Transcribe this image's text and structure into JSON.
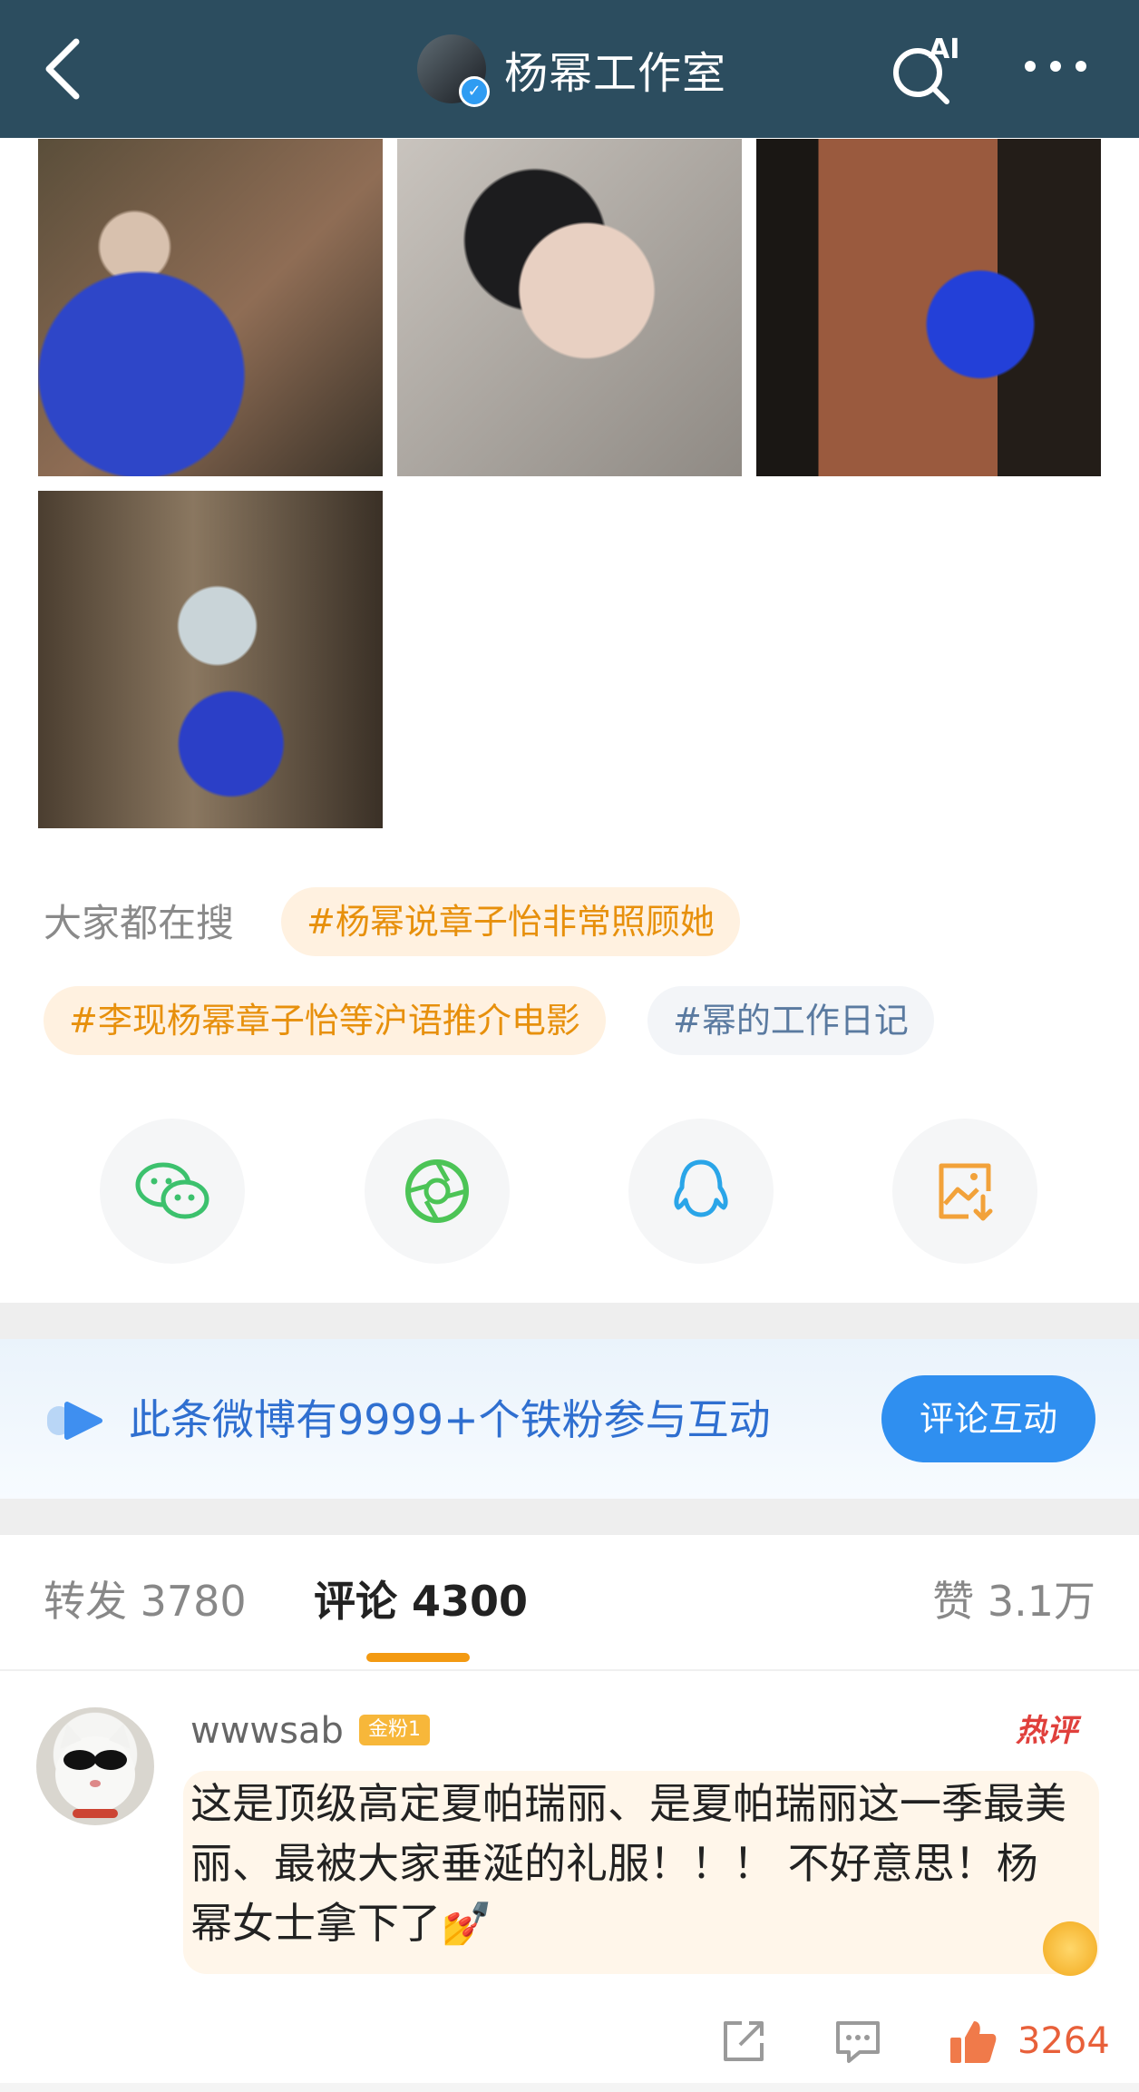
{
  "header": {
    "title": "杨幂工作室",
    "back_icon": "chevron-left-icon",
    "ai_label": "AI",
    "more_icon": "more-icon"
  },
  "hot_search": {
    "label": "大家都在搜",
    "tags": [
      {
        "text": "#杨幂说章子怡非常照顾她",
        "style": "orange"
      },
      {
        "text": "#李现杨幂章子怡等沪语推介电影",
        "style": "orange"
      },
      {
        "text": "#幂的工作日记",
        "style": "gray"
      }
    ]
  },
  "share": {
    "items": [
      {
        "icon": "wechat-icon",
        "color": "#3cc16d"
      },
      {
        "icon": "moments-icon",
        "color": "#4cc456"
      },
      {
        "icon": "qq-icon",
        "color": "#2aa5e8"
      },
      {
        "icon": "save-image-icon",
        "color": "#f2a23a"
      }
    ]
  },
  "banner": {
    "text": "此条微博有9999+个铁粉参与互动",
    "button": "评论互动"
  },
  "tabs": {
    "repost": "转发 3780",
    "comment": "评论 4300",
    "like": "赞 3.1万"
  },
  "comment": {
    "username": "wwwsab",
    "badge": "金粉1",
    "hot_label": "热评",
    "text": "这是顶级高定夏帕瑞丽、是夏帕瑞丽这一季最美丽、最被大家垂涎的礼服！！！ 不好意思！杨幂女士拿下了💅",
    "like_count": "3264"
  },
  "colors": {
    "header_bg": "#2c4d5f",
    "accent_orange": "#f39a12",
    "link_blue": "#2f8ff0"
  }
}
